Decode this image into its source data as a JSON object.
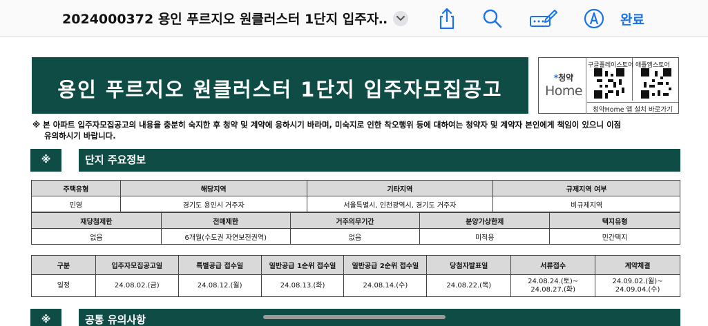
{
  "toolbar": {
    "title": "2024000372 용인 푸르지오 원클러스터 1단지 입주자…",
    "icons": [
      "chevron-down-icon",
      "share-icon",
      "search-icon",
      "markup-pen-icon",
      "navigate-icon"
    ],
    "done_label": "완료"
  },
  "banner": {
    "title": "용인 푸르지오 원클러스터 1단지 입주자모집공고"
  },
  "app_box": {
    "brand_top": "청약",
    "brand_main": "Home",
    "google_label": "구글플레이스토어",
    "apple_label": "애플앱스토어",
    "footer": "청약Home 앱 설치 바로가기"
  },
  "notice": {
    "line1": "※ 본 아파트 입주자모집공고의 내용을 충분히 숙지한 후 청약 및 계약에 응하시기 바라며, 미숙지로 인한 착오행위 등에 대하여는 청약자 및 계약자 본인에게 책임이 있으니 이점",
    "line2": "유의하시기 바랍니다."
  },
  "sections": {
    "mark": "※",
    "info_title": "단지 주요정보",
    "common_title": "공통 유의사항"
  },
  "info_table_1": {
    "headers": [
      "주택유형",
      "해당지역",
      "기타지역",
      "규제지역 여부"
    ],
    "values": [
      "민영",
      "경기도 용인시 거주자",
      "서울특별시, 인천광역시, 경기도 거주자",
      "비규제지역"
    ]
  },
  "info_table_2": {
    "headers": [
      "재당첨제한",
      "전매제한",
      "거주의무기간",
      "분양가상한제",
      "택지유형"
    ],
    "values": [
      "없음",
      "6개월(수도권 자연보전권역)",
      "없음",
      "미적용",
      "민간택지"
    ]
  },
  "schedule_table": {
    "headers": [
      "구분",
      "입주자모집공고일",
      "특별공급 접수일",
      "일반공급 1순위 접수일",
      "일반공급 2순위 접수일",
      "당첨자발표일",
      "서류접수",
      "계약체결"
    ],
    "row_label": "일정",
    "values": [
      "24.08.02.(금)",
      "24.08.12.(월)",
      "24.08.13.(화)",
      "24.08.14.(수)",
      "24.08.22.(목)"
    ],
    "docs_line1": "24.08.24.(토)~",
    "docs_line2": "24.08.27.(화)",
    "contract_line1": "24.09.02.(월)~",
    "contract_line2": "24.09.04.(수)"
  },
  "colors": {
    "banner_bg": "#0f4c46",
    "accent_blue": "#1a73e8",
    "header_cell_bg": "#d9d9d9"
  }
}
